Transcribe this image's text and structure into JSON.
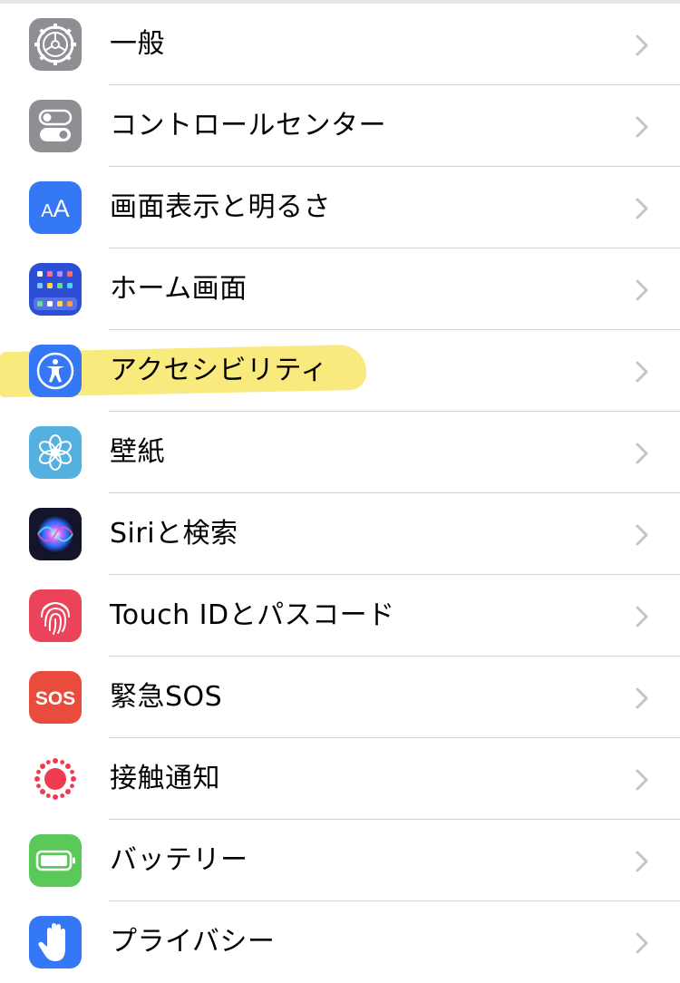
{
  "settings_list": {
    "items": [
      {
        "label": "一般",
        "icon": "gear-icon",
        "icon_color": "#8e8e93"
      },
      {
        "label": "コントロールセンター",
        "icon": "toggles-icon",
        "icon_color": "#8e8e93"
      },
      {
        "label": "画面表示と明るさ",
        "icon": "text-size-icon",
        "icon_color": "#3478f6",
        "icon_text": "AA"
      },
      {
        "label": "ホーム画面",
        "icon": "home-screen-grid-icon",
        "icon_color": "#2d4fd6"
      },
      {
        "label": "アクセシビリティ",
        "icon": "accessibility-icon",
        "icon_color": "#3478f6",
        "highlighted": true
      },
      {
        "label": "壁紙",
        "icon": "flower-icon",
        "icon_color": "#54b0de"
      },
      {
        "label": "Siriと検索",
        "icon": "siri-icon",
        "icon_color": "#1c1c2e"
      },
      {
        "label": "Touch IDとパスコード",
        "icon": "fingerprint-icon",
        "icon_color": "#eb445a"
      },
      {
        "label": "緊急SOS",
        "icon": "sos-icon",
        "icon_color": "#e94b3c",
        "icon_text": "SOS"
      },
      {
        "label": "接触通知",
        "icon": "exposure-notification-icon",
        "icon_color": "#ef3b4e"
      },
      {
        "label": "バッテリー",
        "icon": "battery-icon",
        "icon_color": "#5ac95a"
      },
      {
        "label": "プライバシー",
        "icon": "hand-icon",
        "icon_color": "#3478f6"
      }
    ]
  },
  "colors": {
    "chevron": "#c4c4c7",
    "separator": "#d1d1d6",
    "highlight": "#f6e458"
  }
}
